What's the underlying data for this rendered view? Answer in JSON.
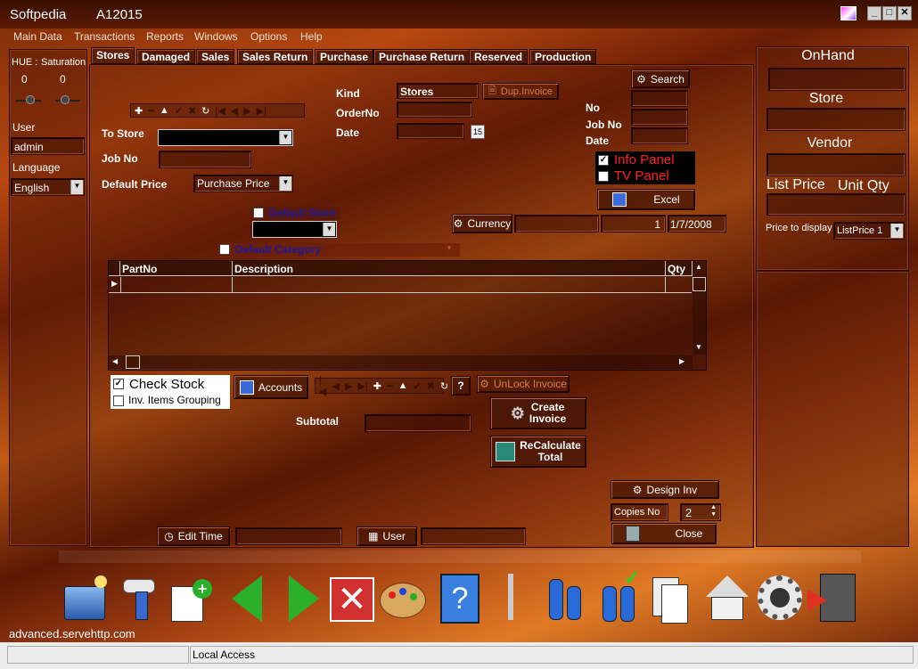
{
  "window": {
    "app": "Softpedia",
    "doc": "A12015"
  },
  "menu": [
    "Main Data",
    "Transactions",
    "Reports",
    "Windows",
    "Options",
    "Help"
  ],
  "left": {
    "hue_label": "HUE :",
    "saturation_label": "Saturation",
    "hue_value": "0",
    "saturation_value": "0",
    "user_label": "User",
    "user_value": "admin",
    "language_label": "Language",
    "language_value": "English"
  },
  "tabs": [
    "Stores",
    "Damaged",
    "Sales",
    "Sales Return",
    "Purchase",
    "Purchase Return",
    "Reserved",
    "Production"
  ],
  "form": {
    "to_store": "To Store",
    "job_no": "Job No",
    "default_price": "Default Price",
    "default_price_value": "Purchase Price",
    "kind": "Kind",
    "kind_value": "Stores",
    "dup_invoice": "Dup.Invoice",
    "order_no": "OrderNo",
    "date": "Date",
    "calendar": "15",
    "search": "Search",
    "no": "No",
    "job_no_r": "Job No",
    "date_r": "Date",
    "info_panel": "Info Panel",
    "tv_panel": "TV Panel",
    "excel": "Excel",
    "default_store": "Default Store",
    "default_category": "Default Category",
    "currency": "Currency",
    "currency_rate": "1",
    "currency_date": "1/7/2008"
  },
  "grid": {
    "columns": [
      "PartNo",
      "Description",
      "Qty"
    ]
  },
  "bottom": {
    "check_stock": "Check Stock",
    "inv_grouping": "Inv. Items Grouping",
    "accounts": "Accounts",
    "help_q": "?",
    "unlock_invoice": "UnLock Invoice",
    "subtotal": "Subtotal",
    "create_invoice_1": "Create",
    "create_invoice_2": "Invoice",
    "recalc_1": "ReCalculate",
    "recalc_2": "Total",
    "design_inv": "Design Inv",
    "copies_no": "Copies No",
    "copies_value": "2",
    "close": "Close",
    "edit_time": "Edit Time",
    "user": "User"
  },
  "right": {
    "onhand": "OnHand",
    "store": "Store",
    "vendor": "Vendor",
    "list_price": "List Price",
    "unit_qty": "Unit Qty",
    "price_to_display": "Price to display",
    "price_to_display_value": "ListPrice 1"
  },
  "footer": {
    "host": "advanced.servehttp.com",
    "access": "Local Access"
  },
  "dock": [
    "folder-icon",
    "scanner-icon",
    "new-document-icon",
    "back-arrow-icon",
    "forward-arrow-icon",
    "delete-icon",
    "palette-icon",
    "help-book-icon",
    "bottles-icon",
    "bottles-check-icon",
    "documents-icon",
    "home-icon",
    "settings-gear-icon",
    "exit-door-icon"
  ],
  "colors": {
    "accent_red": "#ff2020",
    "highlight_blue": "#1a1aa0"
  }
}
